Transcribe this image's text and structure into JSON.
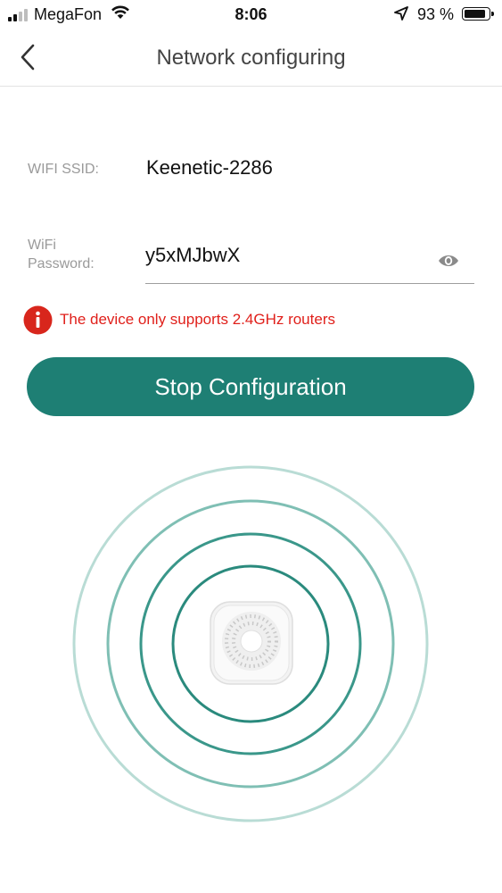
{
  "status_bar": {
    "carrier": "MegaFon",
    "time": "8:06",
    "battery_text": "93 %",
    "battery_level": 0.93,
    "signal_bars": 2,
    "signal_bars_total": 4
  },
  "nav": {
    "title": "Network configuring",
    "back_icon": "chevron-left-icon"
  },
  "form": {
    "ssid_label": "WIFI SSID:",
    "ssid_value": "Keenetic-2286",
    "password_label": "WiFi Password:",
    "password_value": "y5xMJbwX",
    "password_toggle_icon": "eye-icon"
  },
  "warning": {
    "icon": "info-alert-icon",
    "text": "The device only supports 2.4GHz routers"
  },
  "actions": {
    "stop_label": "Stop Configuration"
  },
  "colors": {
    "accent": "#1e7f74",
    "warning": "#e0201b",
    "ring": "#5fb0a3"
  },
  "illustration": {
    "icon": "smart-hub-device-icon",
    "rings": 4
  }
}
